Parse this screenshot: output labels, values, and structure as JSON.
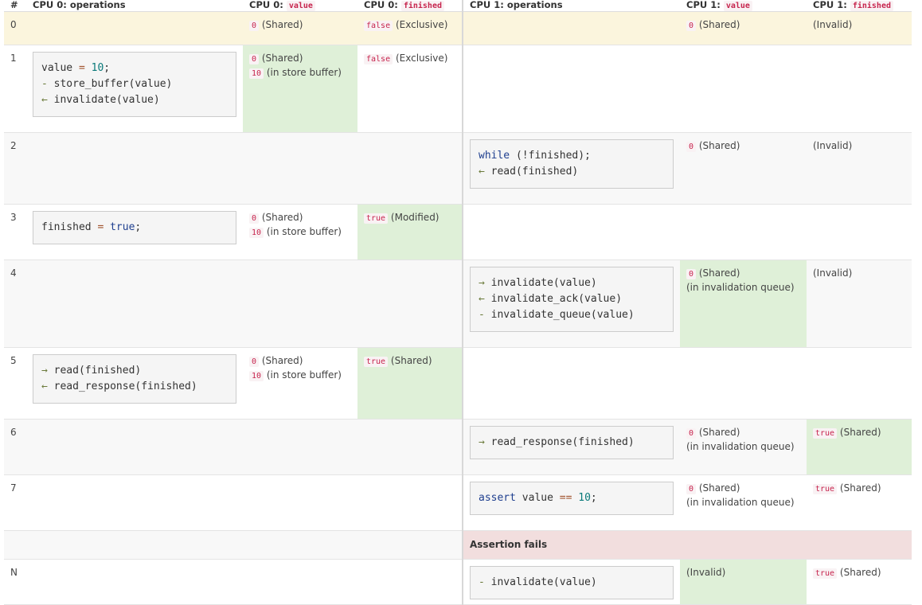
{
  "headers": {
    "num": "#",
    "cpu0_ops": "CPU 0: operations",
    "cpu0_value_prefix": "CPU 0:",
    "cpu0_value_code": "value",
    "cpu0_finished_prefix": "CPU 0:",
    "cpu0_finished_code": "finished",
    "cpu1_ops": "CPU 1: operations",
    "cpu1_value_prefix": "CPU 1:",
    "cpu1_value_code": "value",
    "cpu1_finished_prefix": "CPU 1:",
    "cpu1_finished_code": "finished"
  },
  "rows": {
    "r0": {
      "num": "0",
      "c0v_code": "0",
      "c0v_text": "(Shared)",
      "c0f_code": "false",
      "c0f_text": "(Exclusive)",
      "c1v_code": "0",
      "c1v_text": "(Shared)",
      "c1f_text": "(Invalid)"
    },
    "r1": {
      "num": "1",
      "c0v_code": "0",
      "c0v_text": "(Shared)",
      "c0v_code2": "10",
      "c0v_text2": "(in store buffer)",
      "c0f_code": "false",
      "c0f_text": "(Exclusive)"
    },
    "r2": {
      "num": "2",
      "c1v_code": "0",
      "c1v_text": "(Shared)",
      "c1f_text": "(Invalid)"
    },
    "r3": {
      "num": "3",
      "c0v_code": "0",
      "c0v_text": "(Shared)",
      "c0v_code2": "10",
      "c0v_text2": "(in store buffer)",
      "c0f_code": "true",
      "c0f_text": "(Modified)"
    },
    "r4": {
      "num": "4",
      "c1v_code": "0",
      "c1v_text": "(Shared)",
      "c1v_text2": "(in invalidation queue)",
      "c1f_text": "(Invalid)"
    },
    "r5": {
      "num": "5",
      "c0v_code": "0",
      "c0v_text": "(Shared)",
      "c0v_code2": "10",
      "c0v_text2": "(in store buffer)",
      "c0f_code": "true",
      "c0f_text": "(Shared)"
    },
    "r6": {
      "num": "6",
      "c1v_code": "0",
      "c1v_text": "(Shared)",
      "c1v_text2": "(in invalidation queue)",
      "c1f_code": "true",
      "c1f_text": "(Shared)"
    },
    "r7": {
      "num": "7",
      "c1v_code": "0",
      "c1v_text": "(Shared)",
      "c1v_text2": "(in invalidation queue)",
      "c1f_code": "true",
      "c1f_text": "(Shared)"
    },
    "fail": {
      "text": "Assertion fails"
    },
    "rN": {
      "num": "N",
      "c1v_text": "(Invalid)",
      "c1f_code": "true",
      "c1f_text": "(Shared)"
    }
  },
  "code": {
    "r1_l1a": "value",
    "r1_l1b": "=",
    "r1_l1c": "10",
    "r1_l1d": ";",
    "r1_l2a": "-",
    "r1_l2b": "store_buffer(value)",
    "r1_l3a": "←",
    "r1_l3b": "invalidate(value)",
    "r2_l1a": "while",
    "r2_l1b": "(!finished);",
    "r2_l2a": "←",
    "r2_l2b": "read(finished)",
    "r3_l1a": "finished",
    "r3_l1b": "=",
    "r3_l1c": "true",
    "r3_l1d": ";",
    "r4_l1a": "→",
    "r4_l1b": "invalidate(value)",
    "r4_l2a": "←",
    "r4_l2b": "invalidate_ack(value)",
    "r4_l3a": "-",
    "r4_l3b": "invalidate_queue(value)",
    "r5_l1a": "→",
    "r5_l1b": "read(finished)",
    "r5_l2a": "←",
    "r5_l2b": "read_response(finished)",
    "r6_l1a": "→",
    "r6_l1b": "read_response(finished)",
    "r7_l1a": "assert",
    "r7_l1b": "value",
    "r7_l1c": "==",
    "r7_l1d": "10",
    "r7_l1e": ";",
    "rN_l1a": "-",
    "rN_l1b": "invalidate(value)"
  }
}
